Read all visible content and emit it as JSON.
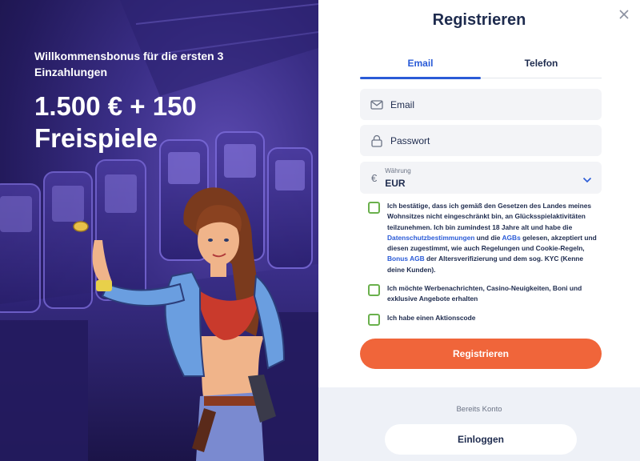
{
  "promo": {
    "subtitle": "Willkommensbonus für die ersten 3 Einzahlungen",
    "headline": "1.500 € + 150 Freispiele"
  },
  "form": {
    "title": "Registrieren",
    "tabs": [
      {
        "label": "Email",
        "active": true
      },
      {
        "label": "Telefon",
        "active": false
      }
    ],
    "email_placeholder": "Email",
    "password_placeholder": "Passwort",
    "currency": {
      "symbol": "€",
      "label": "Währung",
      "value": "EUR"
    },
    "consent": {
      "part1": "Ich bestätige, dass ich gemäß den Gesetzen des Landes meines Wohnsitzes nicht eingeschränkt bin, an Glücksspielaktivitäten teilzunehmen. Ich bin zumindest 18 Jahre alt und habe die ",
      "link_privacy": "Datenschutzbestimmungen",
      "part2": " und die ",
      "link_terms": "AGBs",
      "part3": " gelesen, akzeptiert und diesen zugestimmt, wie auch Regelungen und Cookie-Regeln, ",
      "link_bonus": "Bonus AGB",
      "part4": " der Altersverifizierung und dem sog. KYC (Kenne deine Kunden)."
    },
    "marketing_label": "Ich möchte Werbenachrichten, Casino-Neuigkeiten, Boni und exklusive Angebote erhalten",
    "promo_code_label": "Ich habe einen Aktionscode",
    "submit_label": "Registrieren",
    "existing_account_text": "Bereits Konto",
    "login_label": "Einloggen"
  },
  "icons": {
    "close": "close-icon",
    "email": "mail-icon",
    "password": "lock-icon",
    "currency_chevron": "chevron-down-icon"
  },
  "colors": {
    "accent_blue": "#2a5bd7",
    "submit_orange": "#f0653a",
    "checkbox_green": "#6ab04c",
    "title_navy": "#1e2b4e"
  }
}
